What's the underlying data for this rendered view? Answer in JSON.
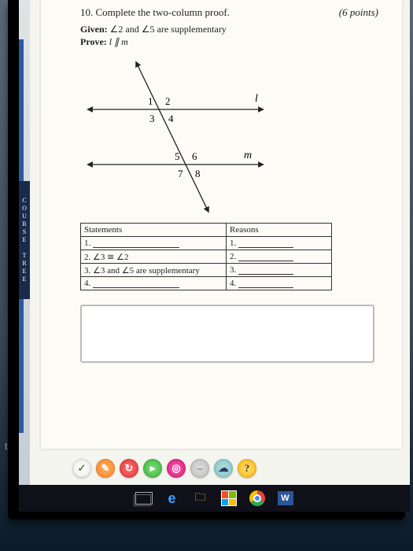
{
  "question": {
    "number": "10.",
    "prompt": "Complete the two-column proof.",
    "points": "(6 points)",
    "given_label": "Given:",
    "given_text": "∠2 and ∠5 are supplementary",
    "prove_label": "Prove:",
    "prove_text": "l ∥ m"
  },
  "diagram": {
    "line_l": "l",
    "line_m": "m",
    "angles": {
      "a1": "1",
      "a2": "2",
      "a3": "3",
      "a4": "4",
      "a5": "5",
      "a6": "6",
      "a7": "7",
      "a8": "8"
    }
  },
  "proof": {
    "headers": {
      "statements": "Statements",
      "reasons": "Reasons"
    },
    "rows": [
      {
        "num": "1.",
        "statement": "",
        "reason_num": "1.",
        "reason": ""
      },
      {
        "num": "2.",
        "statement": "∠3 ≅ ∠2",
        "reason_num": "2.",
        "reason": ""
      },
      {
        "num": "3.",
        "statement": "∠3 and ∠5 are supplementary",
        "reason_num": "3.",
        "reason": ""
      },
      {
        "num": "4.",
        "statement": "",
        "reason_num": "4.",
        "reason": ""
      }
    ]
  },
  "side_ribbon": "COURSE TREE",
  "left_label": "thing.",
  "toolbar_icons": [
    "check",
    "pencil",
    "refresh",
    "play",
    "target",
    "mute",
    "cloud",
    "help"
  ],
  "taskbar_icons": [
    "task-view",
    "edge",
    "file-explorer",
    "store",
    "chrome",
    "word"
  ]
}
